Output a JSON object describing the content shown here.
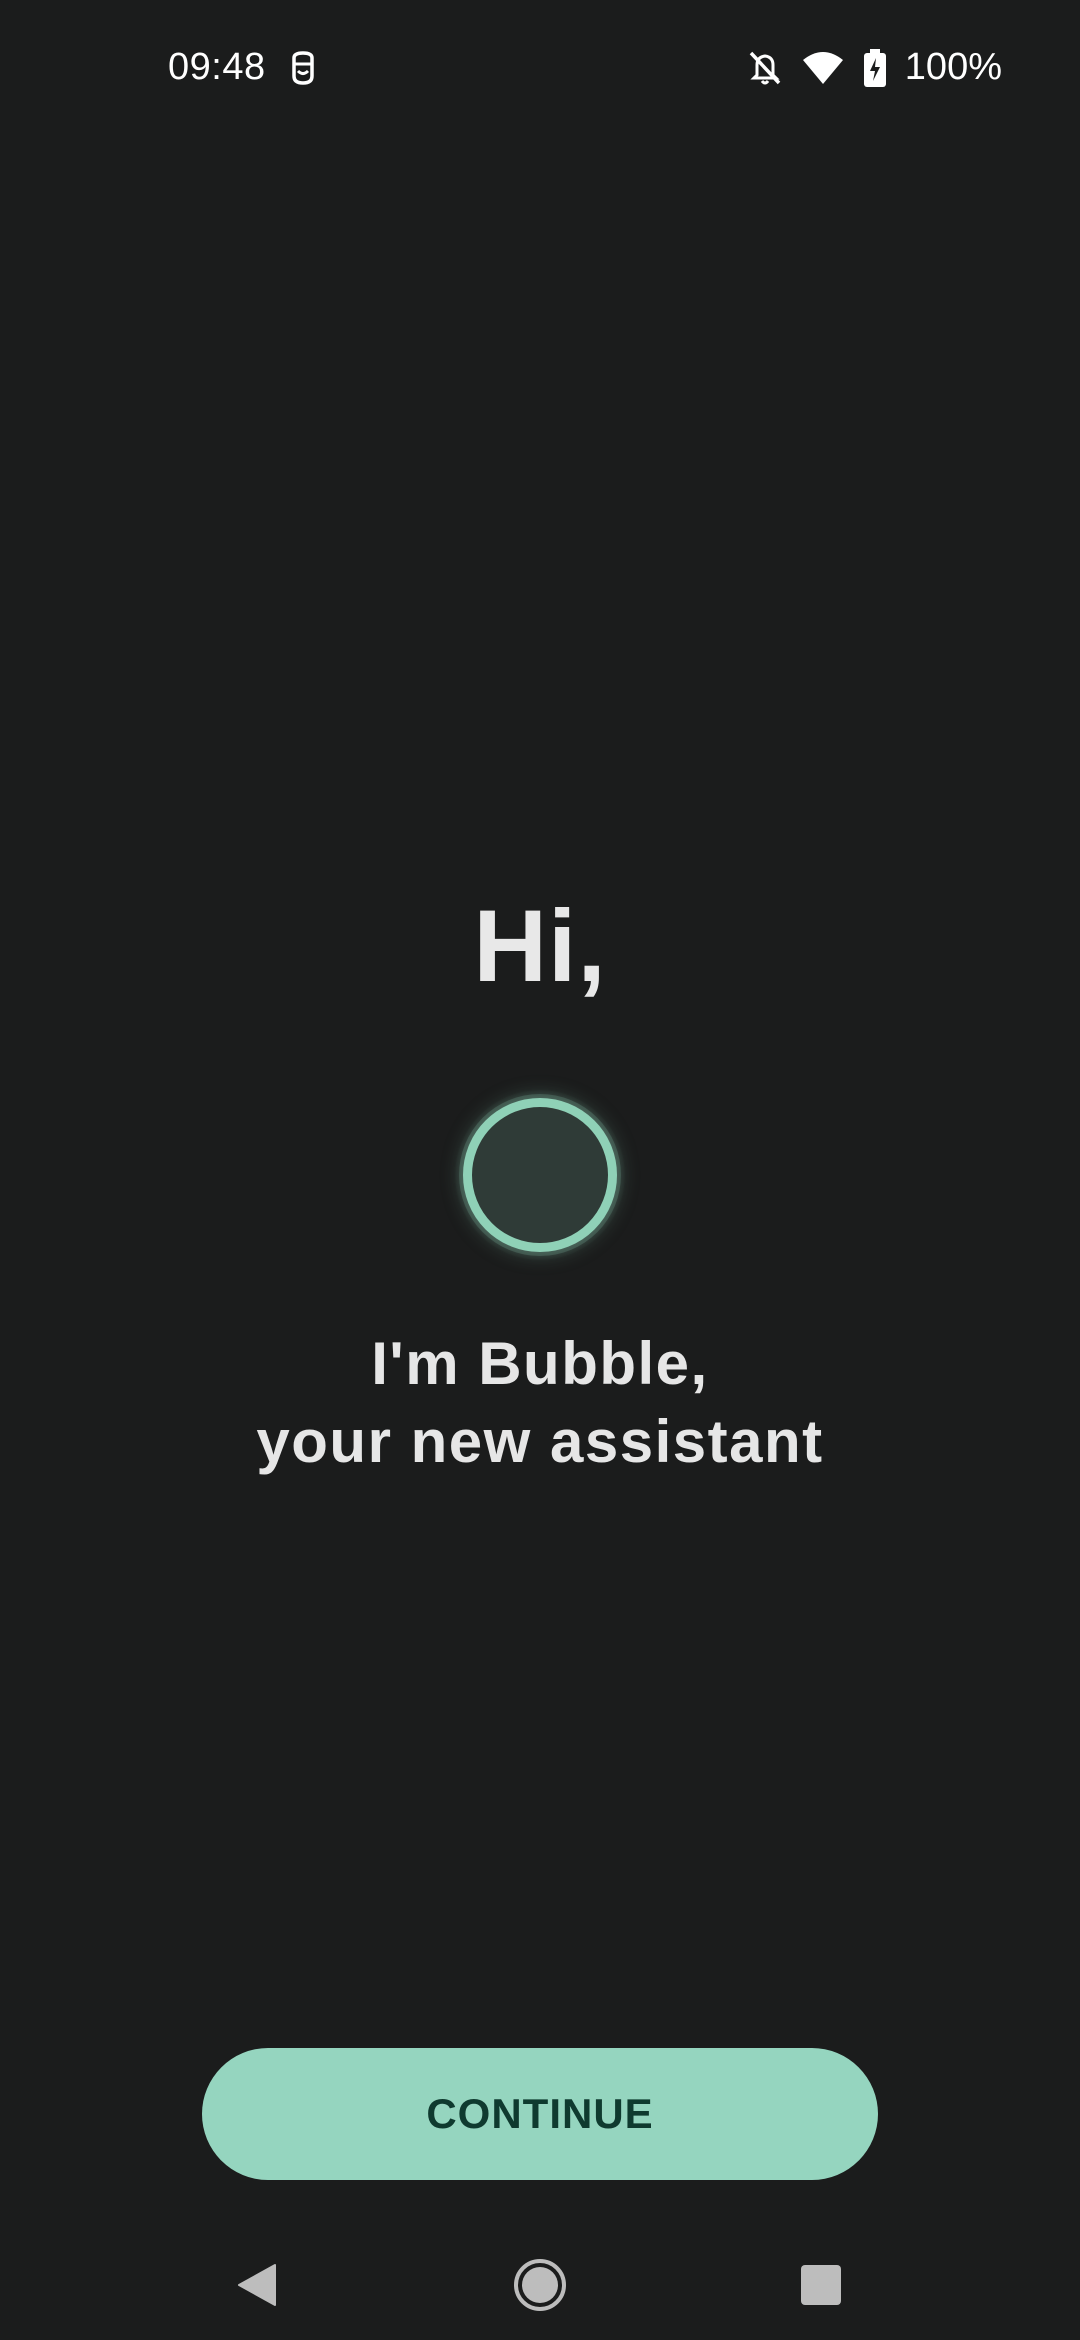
{
  "status_bar": {
    "time": "09:48",
    "battery_percent": "100%",
    "icons": [
      "assistant-status-icon",
      "bell-off-icon",
      "wifi-icon",
      "battery-charging-icon"
    ]
  },
  "main": {
    "greeting": "Hi,",
    "subtitle_line1": "I'm Bubble,",
    "subtitle_line2": "your new assistant"
  },
  "actions": {
    "continue_label": "CONTINUE"
  },
  "nav_bar": {
    "items": [
      "back-icon",
      "home-icon",
      "recents-icon"
    ]
  },
  "colors": {
    "background": "#1b1c1c",
    "accent": "#95d5bf",
    "accent_text": "#0f3a2f",
    "bubble_fill": "#2f3b37",
    "bubble_ring": "#8fd1b7"
  }
}
